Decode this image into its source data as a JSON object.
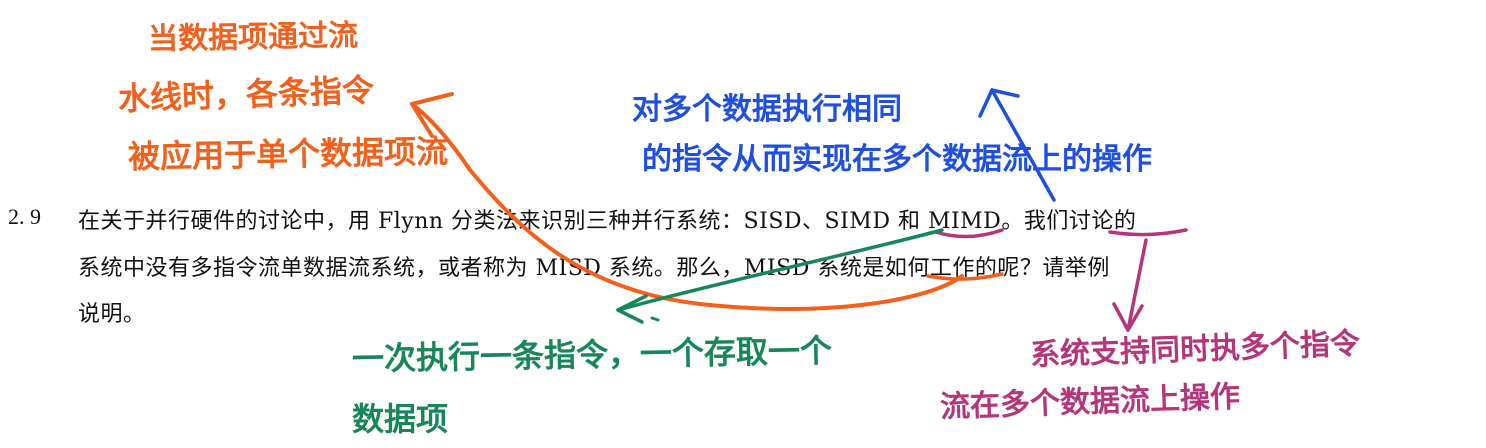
{
  "question": {
    "number": "2. 9",
    "line1": "在关于并行硬件的讨论中，用 Flynn 分类法来识别三种并行系统：SISD、SIMD 和 MIMD。我们讨论的",
    "line2": "系统中没有多指令流单数据流系统，或者称为 MISD 系统。那么，MISD 系统是如何工作的呢？请举例",
    "line3": "说明。"
  },
  "annotations": {
    "orange": {
      "line1": "当数据项通过流",
      "line2": "水线时，各条指令",
      "line3": "被应用于单个数据项流",
      "color": "#f2601c"
    },
    "blue": {
      "line1": "对多个数据执行相同",
      "line2": "的指令从而实现在多个数据流上的操作",
      "color": "#1f4fe0"
    },
    "green": {
      "line1": "一次执行一条指令，一个存取一个",
      "line2": "数据项",
      "color": "#17875a"
    },
    "purple": {
      "line1": "系统支持同时执多个指令",
      "line2": "流在多个数据流上操作",
      "color": "#b5357a"
    }
  }
}
